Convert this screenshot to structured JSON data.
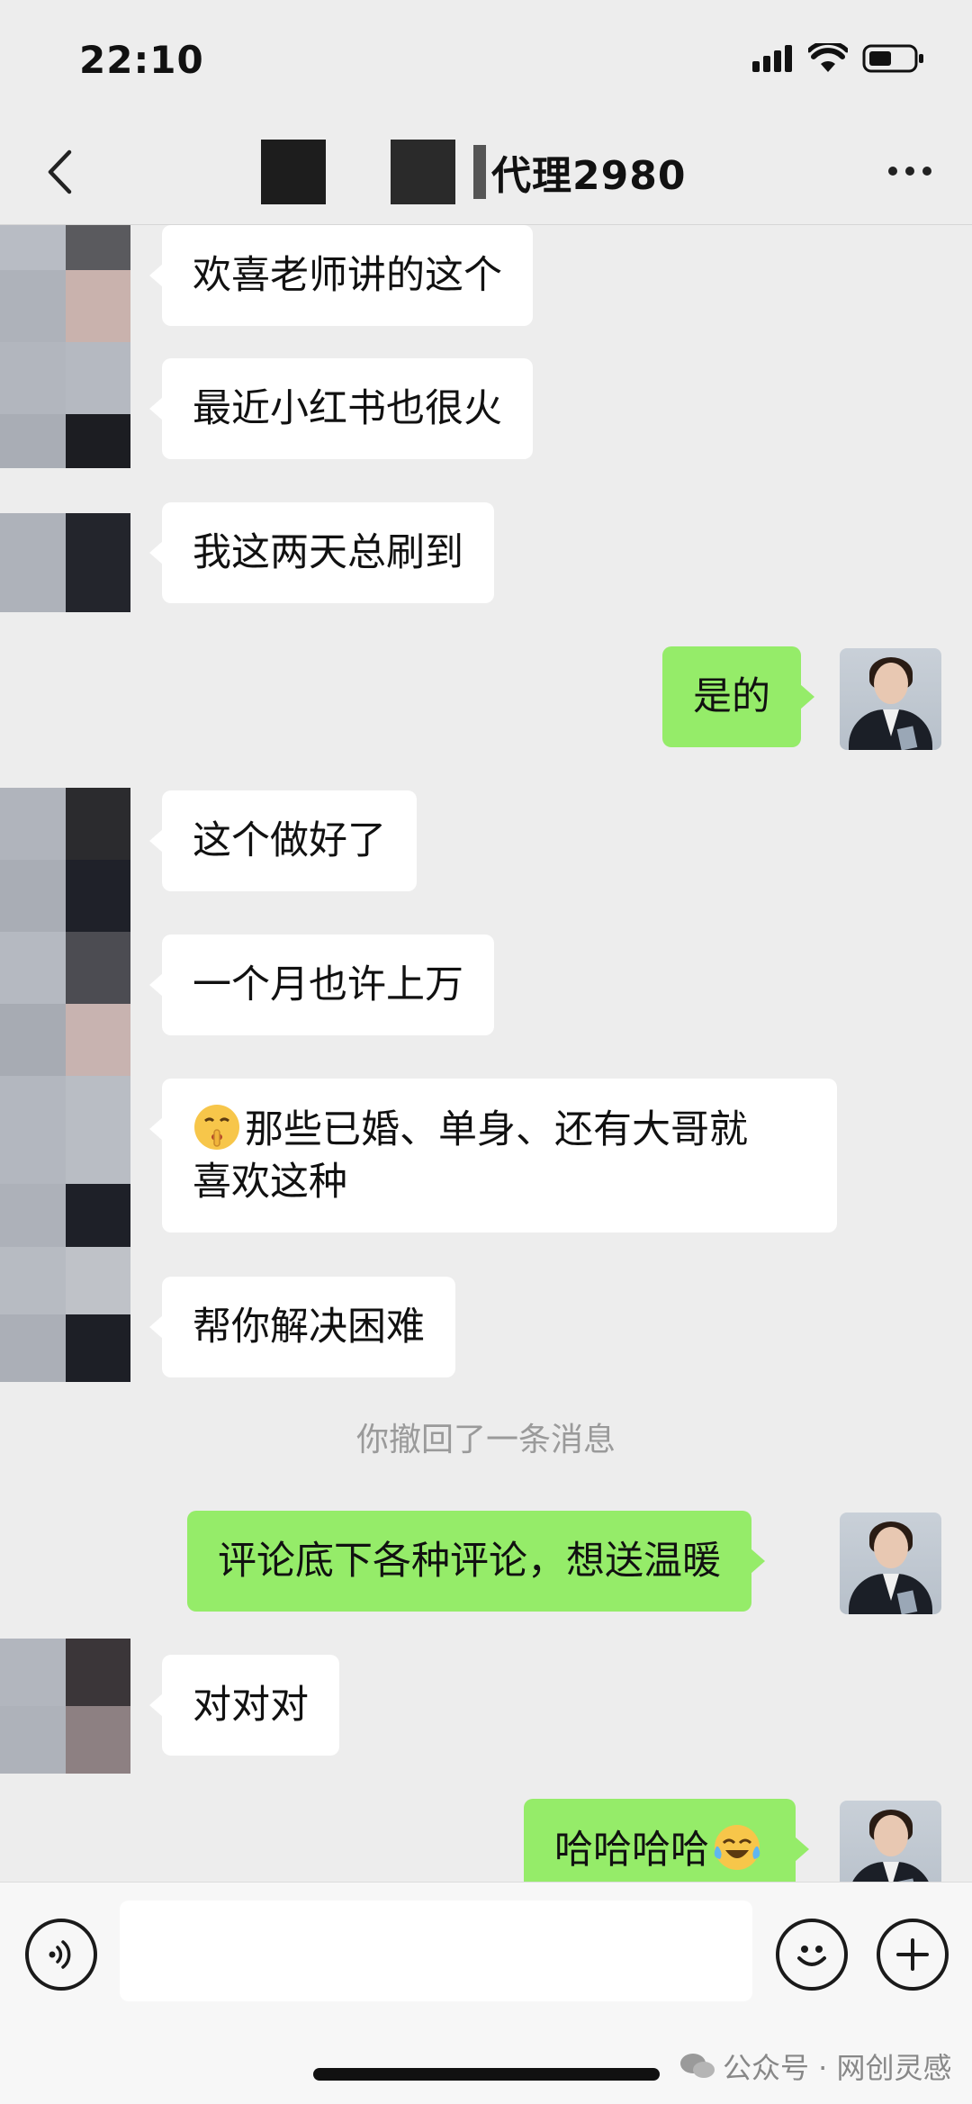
{
  "status_bar": {
    "time": "22:10"
  },
  "nav": {
    "title": "代理2980"
  },
  "messages": [
    {
      "side": "in",
      "text": "欢喜老师讲的这个"
    },
    {
      "side": "in",
      "text": "最近小红书也很火"
    },
    {
      "side": "in",
      "text": "我这两天总刷到"
    },
    {
      "side": "out",
      "text": "是的"
    },
    {
      "side": "in",
      "text": "这个做好了"
    },
    {
      "side": "in",
      "text": "一个月也许上万"
    },
    {
      "side": "in",
      "emoji": "shushing-face-emoji",
      "line1": "那些已婚、单身、还有大哥就",
      "line2": "喜欢这种"
    },
    {
      "side": "in",
      "text": "帮你解决困难"
    },
    {
      "side": "system",
      "text": "你撤回了一条消息"
    },
    {
      "side": "out",
      "text": "评论底下各种评论，想送温暖"
    },
    {
      "side": "in",
      "text": "对对对"
    },
    {
      "side": "out",
      "text": "哈哈哈哈",
      "emoji": "crying-laughing-emoji"
    }
  ],
  "input": {
    "placeholder": ""
  },
  "watermark": {
    "text": "公众号 · 网创灵感"
  },
  "colors": {
    "background": "#ededed",
    "incoming_bubble": "#ffffff",
    "outgoing_bubble": "#95ec69",
    "system_text": "#9a9a9a"
  }
}
